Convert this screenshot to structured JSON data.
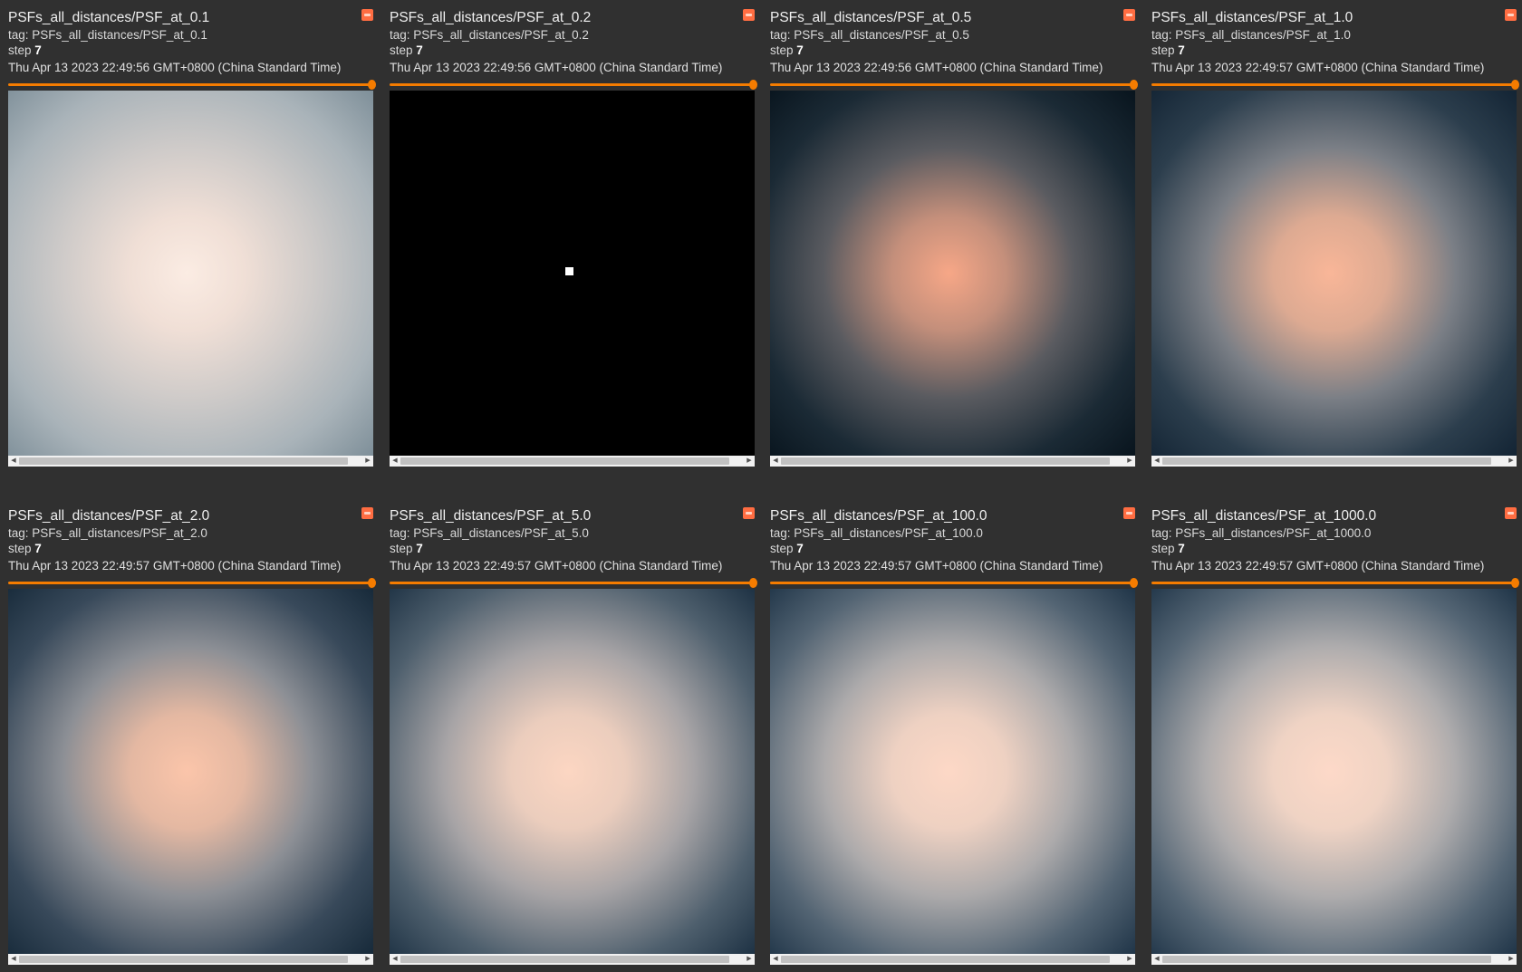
{
  "step_label": "step",
  "cards": [
    {
      "title": "PSFs_all_distances/PSF_at_0.1",
      "tag": "tag: PSFs_all_distances/PSF_at_0.1",
      "step": "7",
      "timestamp": "Thu Apr 13 2023 22:49:56 GMT+0800 (China Standard Time)",
      "psf_colors": [
        "#fbece3",
        "#f0dfd6",
        "#cfcbc9",
        "#a9b3b9",
        "#7e8f99"
      ]
    },
    {
      "title": "PSFs_all_distances/PSF_at_0.2",
      "tag": "tag: PSFs_all_distances/PSF_at_0.2",
      "step": "7",
      "timestamp": "Thu Apr 13 2023 22:49:56 GMT+0800 (China Standard Time)",
      "psf_colors": [
        "#000000",
        "#000000",
        "#000000",
        "#000000",
        "#000000"
      ]
    },
    {
      "title": "PSFs_all_distances/PSF_at_0.5",
      "tag": "tag: PSFs_all_distances/PSF_at_0.5",
      "step": "7",
      "timestamp": "Thu Apr 13 2023 22:49:56 GMT+0800 (China Standard Time)",
      "psf_colors": [
        "#f7a787",
        "#c48f7b",
        "#5a5b60",
        "#1b2a35",
        "#08141d"
      ]
    },
    {
      "title": "PSFs_all_distances/PSF_at_1.0",
      "tag": "tag: PSFs_all_distances/PSF_at_1.0",
      "step": "7",
      "timestamp": "Thu Apr 13 2023 22:49:57 GMT+0800 (China Standard Time)",
      "psf_colors": [
        "#f9b698",
        "#ddaa92",
        "#7b7f86",
        "#2c3e4d",
        "#132434"
      ]
    },
    {
      "title": "PSFs_all_distances/PSF_at_2.0",
      "tag": "tag: PSFs_all_distances/PSF_at_2.0",
      "step": "7",
      "timestamp": "Thu Apr 13 2023 22:49:57 GMT+0800 (China Standard Time)",
      "psf_colors": [
        "#fbc5aa",
        "#e4b8a2",
        "#8c8f95",
        "#38495a",
        "#172a3a"
      ]
    },
    {
      "title": "PSFs_all_distances/PSF_at_5.0",
      "tag": "tag: PSFs_all_distances/PSF_at_5.0",
      "step": "7",
      "timestamp": "Thu Apr 13 2023 22:49:57 GMT+0800 (China Standard Time)",
      "psf_colors": [
        "#fcd6c2",
        "#ebcdbd",
        "#a7a4a6",
        "#4e5f6d",
        "#1e3244"
      ]
    },
    {
      "title": "PSFs_all_distances/PSF_at_100.0",
      "tag": "tag: PSFs_all_distances/PSF_at_100.0",
      "step": "7",
      "timestamp": "Thu Apr 13 2023 22:49:57 GMT+0800 (China Standard Time)",
      "psf_colors": [
        "#fdd8c6",
        "#eed1c2",
        "#acaaab",
        "#536473",
        "#203548"
      ]
    },
    {
      "title": "PSFs_all_distances/PSF_at_1000.0",
      "tag": "tag: PSFs_all_distances/PSF_at_1000.0",
      "step": "7",
      "timestamp": "Thu Apr 13 2023 22:49:57 GMT+0800 (China Standard Time)",
      "psf_colors": [
        "#fdd9c8",
        "#efd3c4",
        "#aeacad",
        "#556675",
        "#203548"
      ]
    }
  ]
}
